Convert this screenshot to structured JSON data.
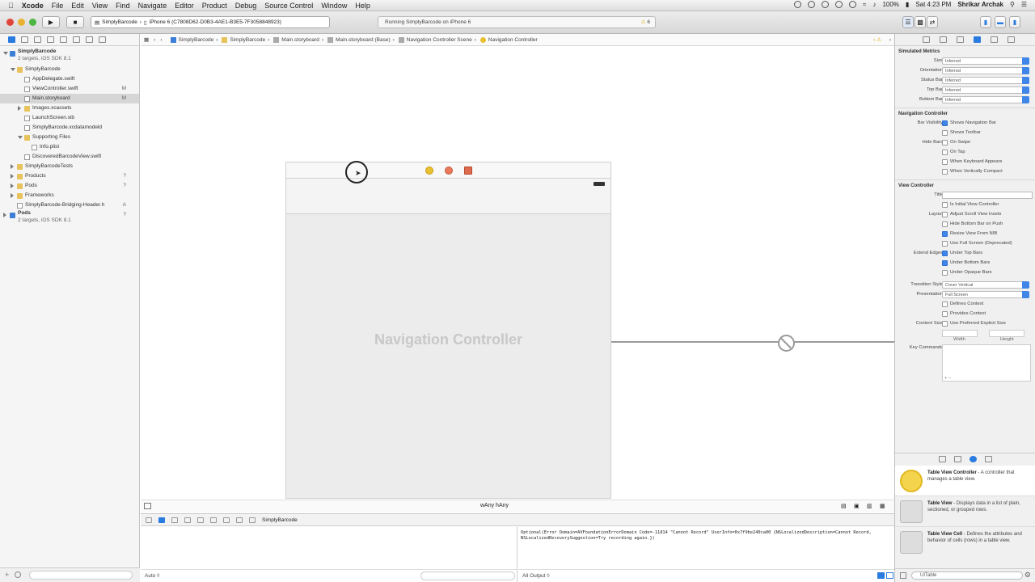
{
  "menubar": {
    "app": "Xcode",
    "items": [
      "File",
      "Edit",
      "View",
      "Find",
      "Navigate",
      "Editor",
      "Product",
      "Debug",
      "Source Control",
      "Window",
      "Help"
    ],
    "battery": "100%",
    "clock": "Sat 4:23 PM",
    "user": "Shrikar Archak"
  },
  "toolbar": {
    "scheme": "SimplyBarcode",
    "device": "iPhone 6 (C7808D62-D0B3-4AE1-B3E5-7F3058848923)",
    "status": "Running SimplyBarcode on iPhone 6",
    "warnings": "6"
  },
  "navigator": {
    "rows": [
      {
        "label": "SimplyBarcode",
        "sub": "2 targets, iOS SDK 8.1",
        "level": 0,
        "kind": "proj",
        "open": true,
        "badge": ""
      },
      {
        "label": "SimplyBarcode",
        "level": 1,
        "kind": "folder",
        "open": true,
        "badge": ""
      },
      {
        "label": "AppDelegate.swift",
        "level": 2,
        "kind": "file",
        "badge": ""
      },
      {
        "label": "ViewController.swift",
        "level": 2,
        "kind": "file",
        "badge": "M"
      },
      {
        "label": "Main.storyboard",
        "level": 2,
        "kind": "file",
        "badge": "M",
        "selected": true
      },
      {
        "label": "Images.xcassets",
        "level": 2,
        "kind": "folder",
        "badge": ""
      },
      {
        "label": "LaunchScreen.xib",
        "level": 2,
        "kind": "file",
        "badge": ""
      },
      {
        "label": "SimplyBarcode.xcdatamodeld",
        "level": 2,
        "kind": "file",
        "badge": ""
      },
      {
        "label": "Supporting Files",
        "level": 2,
        "kind": "folder",
        "open": true,
        "badge": ""
      },
      {
        "label": "Info.plist",
        "level": 3,
        "kind": "file",
        "badge": ""
      },
      {
        "label": "DiscoveredBarcodeView.swift",
        "level": 2,
        "kind": "file",
        "badge": ""
      },
      {
        "label": "SimplyBarcodeTests",
        "level": 1,
        "kind": "folder",
        "open": false,
        "badge": ""
      },
      {
        "label": "Products",
        "level": 1,
        "kind": "folder",
        "open": false,
        "badge": "?"
      },
      {
        "label": "Pods",
        "level": 1,
        "kind": "folder",
        "open": false,
        "badge": "?"
      },
      {
        "label": "Frameworks",
        "level": 1,
        "kind": "folder",
        "open": false,
        "badge": ""
      },
      {
        "label": "SimplyBarcode-Bridging-Header.h",
        "level": 1,
        "kind": "file",
        "badge": "A"
      },
      {
        "label": "Pods",
        "sub": "2 targets, iOS SDK 8.1",
        "level": 0,
        "kind": "proj",
        "open": false,
        "badge": "?"
      }
    ]
  },
  "jumpbar": {
    "crumbs": [
      "SimplyBarcode",
      "SimplyBarcode",
      "Main.storyboard",
      "Main.storyboard (Base)",
      "Navigation Controller Scene",
      "Navigation Controller"
    ]
  },
  "canvas": {
    "scene_title": "Navigation Controller",
    "size_class": "wAny hAny"
  },
  "debug": {
    "target": "SimplyBarcode",
    "var_filter": "Auto ◊",
    "output_filter": "All Output ◊",
    "console": "Optional(Error Domain=AVFoundationErrorDomain Code=-11814 \"Cannot Record\" UserInfo=0x7f9be240ca00 {NSLocalizedDescription=Cannot Record, NSLocalizedRecoverySuggestion=Try recording again.})"
  },
  "inspector": {
    "simulated": {
      "title": "Simulated Metrics",
      "rows": [
        {
          "label": "Size",
          "value": "Inferred"
        },
        {
          "label": "Orientation",
          "value": "Inferred"
        },
        {
          "label": "Status Bar",
          "value": "Inferred"
        },
        {
          "label": "Top Bar",
          "value": "Inferred"
        },
        {
          "label": "Bottom Bar",
          "value": "Inferred"
        }
      ]
    },
    "navcontroller": {
      "title": "Navigation Controller",
      "bar_visibility_label": "Bar Visibility",
      "hide_bars_label": "Hide Bars",
      "checks": [
        {
          "label": "Shows Navigation Bar",
          "on": true
        },
        {
          "label": "Shows Toolbar",
          "on": false
        },
        {
          "label": "On Swipe",
          "on": false
        },
        {
          "label": "On Tap",
          "on": false
        },
        {
          "label": "When Keyboard Appears",
          "on": false
        },
        {
          "label": "When Vertically Compact",
          "on": false
        }
      ]
    },
    "viewcontroller": {
      "title": "View Controller",
      "title_label": "Title",
      "initial": "Is Initial View Controller",
      "layout_label": "Layout",
      "layout_checks": [
        {
          "label": "Adjust Scroll View Insets",
          "on": false
        },
        {
          "label": "Hide Bottom Bar on Push",
          "on": false
        },
        {
          "label": "Resize View From NIB",
          "on": true
        },
        {
          "label": "Use Full Screen (Deprecated)",
          "on": false
        }
      ],
      "extend_label": "Extend Edges",
      "extend_checks": [
        {
          "label": "Under Top Bars",
          "on": true
        },
        {
          "label": "Under Bottom Bars",
          "on": true
        },
        {
          "label": "Under Opaque Bars",
          "on": false
        }
      ],
      "transition_label": "Transition Style",
      "transition": "Cover Vertical",
      "presentation_label": "Presentation",
      "presentation": "Full Screen",
      "defines_context": "Defines Context",
      "provides_context": "Provides Context",
      "content_size_label": "Content Size",
      "preferred_size": "Use Preferred Explicit Size",
      "width_label": "Width",
      "height_label": "Height",
      "key_commands_label": "Key Commands"
    }
  },
  "library": {
    "items": [
      {
        "name": "Table View Controller",
        "desc": " - A controller that manages a table view."
      },
      {
        "name": "Table View",
        "desc": " - Displays data in a list of plain, sectioned, or grouped rows."
      },
      {
        "name": "Table View Cell",
        "desc": " - Defines the attributes and behavior of cells (rows) in a table view."
      }
    ],
    "filter": "UITable"
  }
}
